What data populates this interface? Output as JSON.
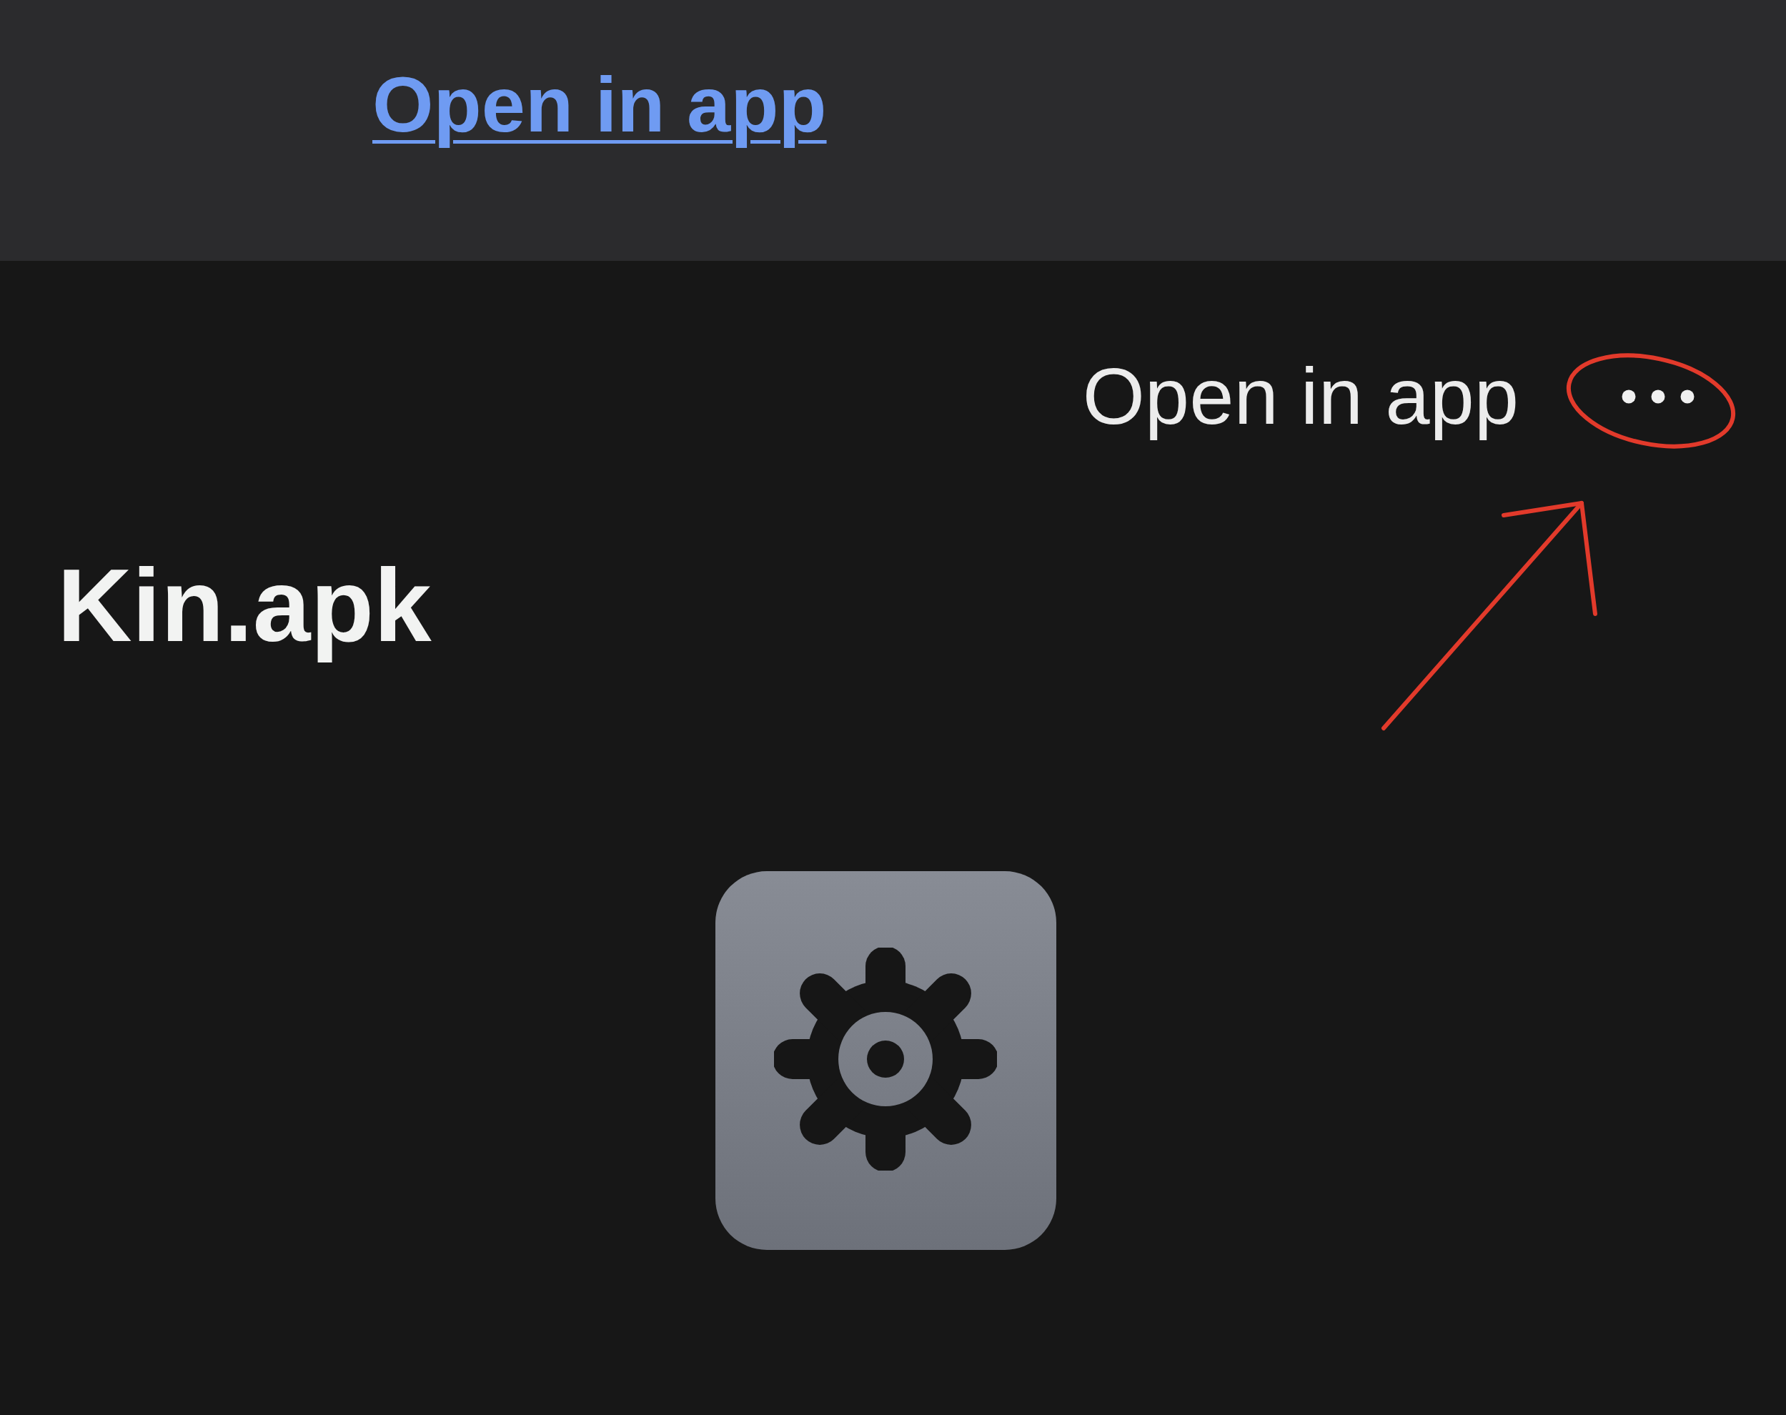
{
  "banner": {
    "link": "Open in app"
  },
  "header": {
    "open_in_app": "Open in app"
  },
  "file": {
    "name": "Kin.apk"
  },
  "annotations": [
    {
      "kind": "ellipse"
    },
    {
      "kind": "arrow"
    }
  ]
}
